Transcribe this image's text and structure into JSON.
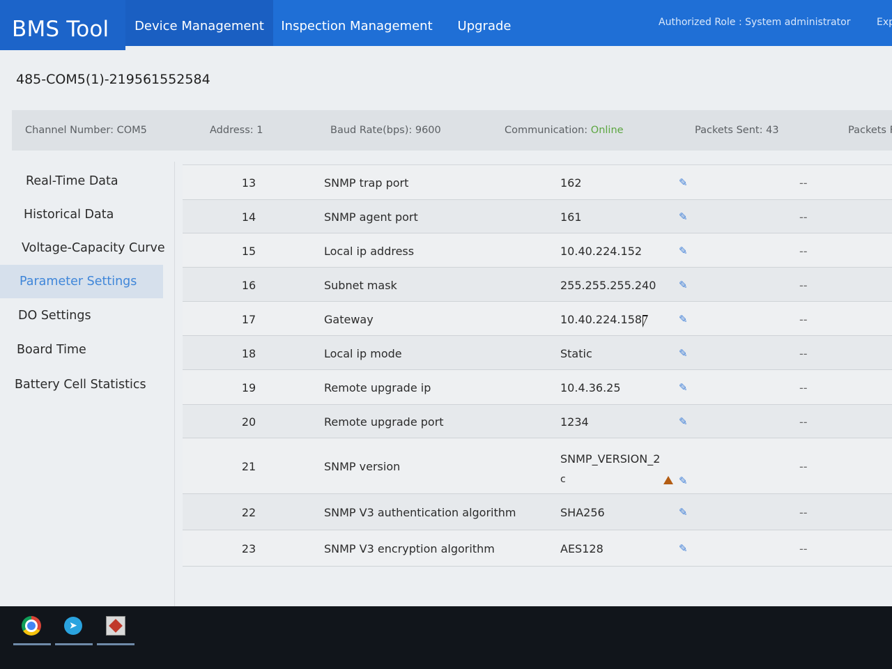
{
  "header": {
    "brand": "BMS Tool",
    "nav": [
      {
        "label": "Device Management"
      },
      {
        "label": "Inspection Management"
      },
      {
        "label": "Upgrade"
      }
    ],
    "role": "Authorized Role : System administrator",
    "exit_label": "Exp"
  },
  "device": {
    "title": "485-COM5(1)-219561552584"
  },
  "info": {
    "channel": "Channel Number: COM5",
    "address": "Address: 1",
    "baud": "Baud Rate(bps): 9600",
    "comm_label": "Communication: ",
    "comm_status": "Online",
    "packets_sent": "Packets Sent: 43",
    "packets_recv": "Packets F"
  },
  "sidebar": {
    "items": [
      {
        "label": "Real-Time Data"
      },
      {
        "label": "Historical Data"
      },
      {
        "label": "Voltage-Capacity Curve"
      },
      {
        "label": "Parameter Settings"
      },
      {
        "label": "DO Settings"
      },
      {
        "label": "Board Time"
      },
      {
        "label": "Battery Cell Statistics"
      }
    ],
    "active": "Parameter Settings"
  },
  "table": {
    "rows": [
      {
        "num": "13",
        "name": "SNMP trap port",
        "value": "162",
        "value2": "",
        "dash": "--"
      },
      {
        "num": "14",
        "name": "SNMP agent port",
        "value": "161",
        "value2": "",
        "dash": "--"
      },
      {
        "num": "15",
        "name": "Local ip address",
        "value": "10.40.224.152",
        "value2": "",
        "dash": "--"
      },
      {
        "num": "16",
        "name": "Subnet mask",
        "value": "255.255.255.240",
        "value2": "",
        "dash": "--"
      },
      {
        "num": "17",
        "name": "Gateway",
        "value": "10.40.224.158",
        "value2": "",
        "dash": "--"
      },
      {
        "num": "18",
        "name": "Local ip mode",
        "value": "Static",
        "value2": "",
        "dash": "--"
      },
      {
        "num": "19",
        "name": "Remote upgrade ip",
        "value": "10.4.36.25",
        "value2": "",
        "dash": "--"
      },
      {
        "num": "20",
        "name": "Remote upgrade port",
        "value": "1234",
        "value2": "",
        "dash": "--"
      },
      {
        "num": "21",
        "name": "SNMP version",
        "value": "SNMP_VERSION_2",
        "value2": "c",
        "dash": "--"
      },
      {
        "num": "22",
        "name": "SNMP V3 authentication algorithm",
        "value": "SHA256",
        "value2": "",
        "dash": "--"
      },
      {
        "num": "23",
        "name": "SNMP V3 encryption algorithm",
        "value": "AES128",
        "value2": "",
        "dash": "--"
      }
    ],
    "edit_icon": "pencil-icon",
    "warning_icon": "warning-icon"
  },
  "taskbar": {
    "apps": [
      "chrome-icon",
      "telegram-icon",
      "app-icon"
    ]
  },
  "colors": {
    "header": "#1f6fd6",
    "online": "#5ca640",
    "active_sidebar_text": "#3f86d9",
    "edit": "#3f7fd8",
    "warning": "#b35d13"
  }
}
